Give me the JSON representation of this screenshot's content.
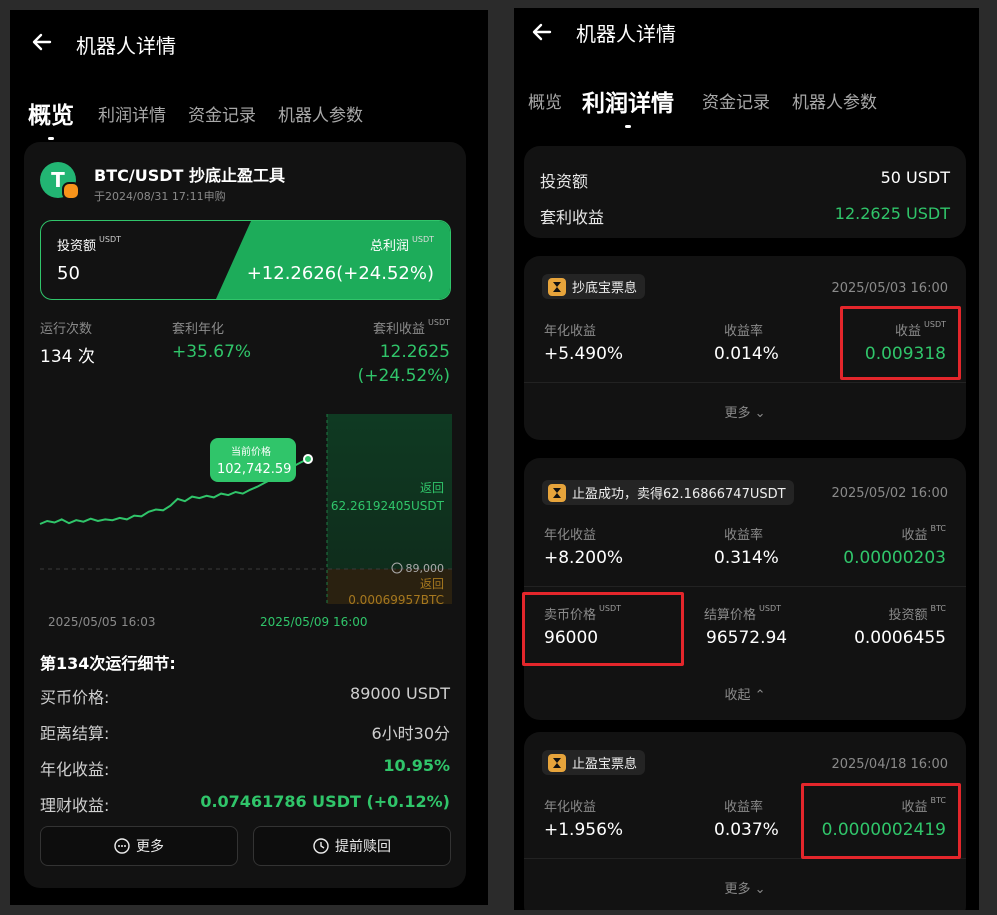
{
  "left": {
    "header_title": "机器人详情",
    "tabs": [
      "概览",
      "利润详情",
      "资金记录",
      "机器人参数"
    ],
    "product": {
      "name": "BTC/USDT 抄底止盈工具",
      "subtitle": "于2024/08/31 17:11申购"
    },
    "summary": {
      "invest_label": "投资额",
      "invest_unit": "USDT",
      "invest_value": "50",
      "profit_label": "总利润",
      "profit_unit": "USDT",
      "profit_value": "+12.2626(+24.52%)"
    },
    "stats": {
      "runs_label": "运行次数",
      "runs_value": "134 次",
      "annual_label": "套利年化",
      "annual_value": "+35.67%",
      "income_label": "套利收益",
      "income_unit": "USDT",
      "income_value": "12.2625",
      "income_pct": "(+24.52%)"
    },
    "chart": {
      "tooltip_label": "当前价格",
      "tooltip_value": "102,742.59",
      "return_label": "返回",
      "return_value": "62.26192405USDT",
      "price_line": "89,000",
      "return2_label": "返回",
      "return2_value": "0.00069957BTC",
      "x_start": "2025/05/05 16:03",
      "x_end": "2025/05/09 16:00"
    },
    "chart_data": {
      "type": "line",
      "x": [
        "2025/05/05 16:03",
        "2025/05/09 16:00"
      ],
      "series": [
        {
          "values": [
            94200,
            94600,
            94400,
            94800,
            94300,
            94700,
            94500,
            94900,
            94600,
            94800,
            94700,
            95000,
            94800,
            95300,
            95200,
            95800,
            96100,
            96000,
            96600,
            97500,
            97200,
            97800,
            97600,
            97900,
            97700,
            98200,
            98000,
            98400,
            98200,
            98700,
            99100,
            99600,
            100100,
            100700,
            101300,
            101800,
            102300,
            102742.59
          ]
        }
      ],
      "markers": {
        "current_price": 102742.59,
        "buy_price": 89000
      }
    },
    "detail": {
      "title": "第134次运行细节:",
      "rows": [
        {
          "label": "买币价格:",
          "value": "89000 USDT"
        },
        {
          "label": "距离结算:",
          "value": "6小时30分"
        },
        {
          "label": "年化收益:",
          "value": "10.95%"
        },
        {
          "label": "理财收益:",
          "value": "0.07461786 USDT (+0.12%)"
        }
      ]
    },
    "buttons": {
      "more": "更多",
      "redeem": "提前赎回"
    }
  },
  "right": {
    "header_title": "机器人详情",
    "tabs": [
      "概览",
      "利润详情",
      "资金记录",
      "机器人参数"
    ],
    "summary": {
      "invest_label": "投资额",
      "invest_value": "50 USDT",
      "arb_label": "套利收益",
      "arb_value": "12.2625 USDT"
    },
    "cards": [
      {
        "badge": "抄底宝票息",
        "date": "2025/05/03 16:00",
        "annual_label": "年化收益",
        "annual_value": "+5.490%",
        "rate_label": "收益率",
        "rate_value": "0.014%",
        "income_label": "收益",
        "income_unit": "USDT",
        "income_value": "0.009318",
        "toggle": "更多"
      },
      {
        "badge": "止盈成功，卖得62.16866747USDT",
        "date": "2025/05/02 16:00",
        "annual_label": "年化收益",
        "annual_value": "+8.200%",
        "rate_label": "收益率",
        "rate_value": "0.314%",
        "income_label": "收益",
        "income_unit": "BTC",
        "income_value": "0.00000203",
        "sell_label": "卖币价格",
        "sell_unit": "USDT",
        "sell_value": "96000",
        "settle_label": "结算价格",
        "settle_unit": "USDT",
        "settle_value": "96572.94",
        "invest_label": "投资额",
        "invest_unit": "BTC",
        "invest_value": "0.0006455",
        "toggle": "收起"
      },
      {
        "badge": "止盈宝票息",
        "date": "2025/04/18 16:00",
        "annual_label": "年化收益",
        "annual_value": "+1.956%",
        "rate_label": "收益率",
        "rate_value": "0.037%",
        "income_label": "收益",
        "income_unit": "BTC",
        "income_value": "0.0000002419",
        "toggle": "更多"
      }
    ]
  },
  "colors": {
    "accent_green": "#30c56a",
    "highlight_red": "#e3262b",
    "badge_orange": "#e7a43b"
  }
}
